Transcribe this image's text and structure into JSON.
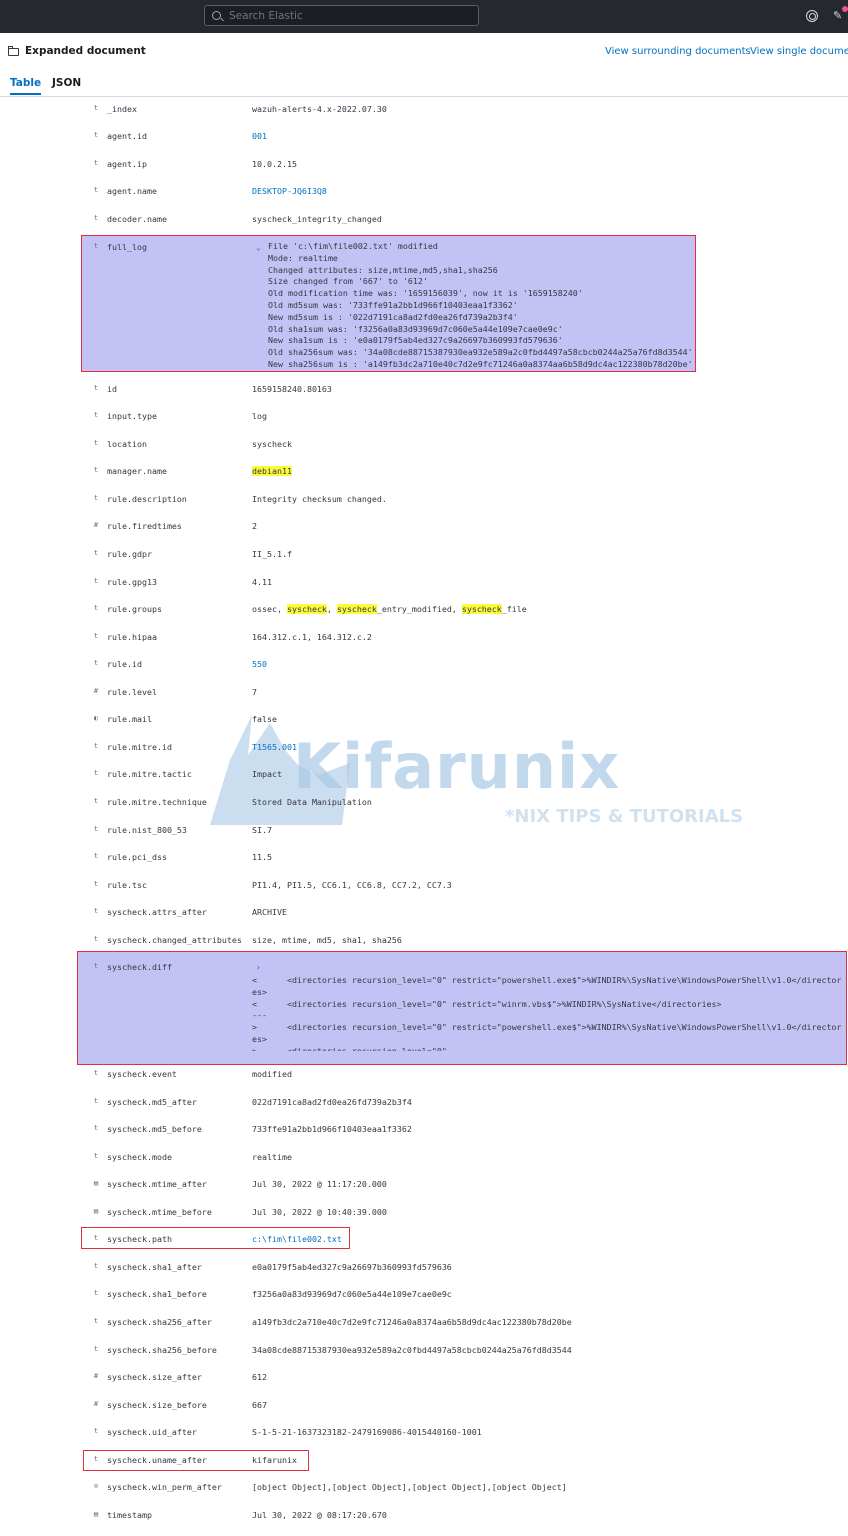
{
  "topbar": {
    "search_placeholder": "Search Elastic"
  },
  "header": {
    "title": "Expanded document",
    "view_surrounding": "View surrounding documents",
    "view_single": "View single document"
  },
  "tabs": {
    "table": "Table",
    "json": "JSON"
  },
  "watermark": {
    "brand": "Kifarunix",
    "tagline": "*NIX TIPS & TUTORIALS"
  },
  "fields": [
    {
      "type": "t",
      "name": "_index",
      "value": "wazuh-alerts-4.x-2022.07.30"
    },
    {
      "type": "t",
      "name": "agent.id",
      "value": "001"
    },
    {
      "type": "t",
      "name": "agent.ip",
      "value": "10.0.2.15"
    },
    {
      "type": "t",
      "name": "agent.name",
      "value": "DESKTOP-JQ6I3Q8"
    },
    {
      "type": "t",
      "name": "decoder.name",
      "value": "syscheck_integrity_changed"
    },
    {
      "type": "t",
      "name": "full_log",
      "value": ""
    },
    {
      "type": "t",
      "name": "id",
      "value": "1659158240.80163"
    },
    {
      "type": "t",
      "name": "input.type",
      "value": "log"
    },
    {
      "type": "t",
      "name": "location",
      "value": "syscheck"
    },
    {
      "type": "t",
      "name": "manager.name",
      "value": "debian11"
    },
    {
      "type": "t",
      "name": "rule.description",
      "value": "Integrity checksum changed."
    },
    {
      "type": "#",
      "name": "rule.firedtimes",
      "value": "2"
    },
    {
      "type": "t",
      "name": "rule.gdpr",
      "value": "II_5.1.f"
    },
    {
      "type": "t",
      "name": "rule.gpg13",
      "value": "4.11"
    },
    {
      "type": "t",
      "name": "rule.groups",
      "value": ""
    },
    {
      "type": "t",
      "name": "rule.hipaa",
      "value": "164.312.c.1, 164.312.c.2"
    },
    {
      "type": "t",
      "name": "rule.id",
      "value": "550"
    },
    {
      "type": "#",
      "name": "rule.level",
      "value": "7"
    },
    {
      "type": "◐",
      "name": "rule.mail",
      "value": "false"
    },
    {
      "type": "t",
      "name": "rule.mitre.id",
      "value": "T1565.001"
    },
    {
      "type": "t",
      "name": "rule.mitre.tactic",
      "value": "Impact"
    },
    {
      "type": "t",
      "name": "rule.mitre.technique",
      "value": "Stored Data Manipulation"
    },
    {
      "type": "t",
      "name": "rule.nist_800_53",
      "value": "SI.7"
    },
    {
      "type": "t",
      "name": "rule.pci_dss",
      "value": "11.5"
    },
    {
      "type": "t",
      "name": "rule.tsc",
      "value": "PI1.4, PI1.5, CC6.1, CC6.8, CC7.2, CC7.3"
    },
    {
      "type": "t",
      "name": "syscheck.attrs_after",
      "value": "ARCHIVE"
    },
    {
      "type": "t",
      "name": "syscheck.changed_attributes",
      "value": "size, mtime, md5, sha1, sha256"
    },
    {
      "type": "t",
      "name": "syscheck.diff",
      "value": ""
    },
    {
      "type": "t",
      "name": "syscheck.event",
      "value": "modified"
    },
    {
      "type": "t",
      "name": "syscheck.md5_after",
      "value": "022d7191ca8ad2fd0ea26fd739a2b3f4"
    },
    {
      "type": "t",
      "name": "syscheck.md5_before",
      "value": "733ffe91a2bb1d966f10403eaa1f3362"
    },
    {
      "type": "t",
      "name": "syscheck.mode",
      "value": "realtime"
    },
    {
      "type": "▤",
      "name": "syscheck.mtime_after",
      "value": "Jul 30, 2022 @ 11:17:20.000"
    },
    {
      "type": "▤",
      "name": "syscheck.mtime_before",
      "value": "Jul 30, 2022 @ 10:40:39.000"
    },
    {
      "type": "t",
      "name": "syscheck.path",
      "value": "c:\\fim\\file002.txt"
    },
    {
      "type": "t",
      "name": "syscheck.sha1_after",
      "value": "e0a0179f5ab4ed327c9a26697b360993fd579636"
    },
    {
      "type": "t",
      "name": "syscheck.sha1_before",
      "value": "f3256a0a83d93969d7c060e5a44e109e7cae0e9c"
    },
    {
      "type": "t",
      "name": "syscheck.sha256_after",
      "value": "a149fb3dc2a710e40c7d2e9fc71246a0a8374aa6b58d9dc4ac122380b78d20be"
    },
    {
      "type": "t",
      "name": "syscheck.sha256_before",
      "value": "34a08cde88715387930ea932e589a2c0fbd4497a58cbcb0244a25a76fd8d3544"
    },
    {
      "type": "#",
      "name": "syscheck.size_after",
      "value": "612"
    },
    {
      "type": "#",
      "name": "syscheck.size_before",
      "value": "667"
    },
    {
      "type": "t",
      "name": "syscheck.uid_after",
      "value": "S-1-5-21-1637323182-2479169086-4015440160-1001"
    },
    {
      "type": "t",
      "name": "syscheck.uname_after",
      "value": "kifarunix"
    },
    {
      "type": "⊙",
      "name": "syscheck.win_perm_after",
      "value": "[object Object],[object Object],[object Object],[object Object]"
    },
    {
      "type": "▤",
      "name": "timestamp",
      "value": "Jul 30, 2022 @ 08:17:20.670"
    }
  ],
  "full_log_lines": [
    "File 'c:\\fim\\file002.txt' modified",
    "Mode: realtime",
    "Changed attributes: size,mtime,md5,sha1,sha256",
    "Size changed from '667' to '612'",
    "Old modification time was: '1659156039', now it is '1659158240'",
    "Old md5sum was: '733ffe91a2bb1d966f10403eaa1f3362'",
    "New md5sum is : '022d7191ca8ad2fd0ea26fd739a2b3f4'",
    "Old sha1sum was: 'f3256a0a83d93969d7c060e5a44e109e7cae0e9c'",
    "New sha1sum is : 'e0a0179f5ab4ed327c9a26697b360993fd579636'",
    "Old sha256sum was: '34a08cde88715387930ea932e589a2c0fbd4497a58cbcb0244a25a76fd8d3544'",
    "New sha256sum is : 'a149fb3dc2a710e40c7d2e9fc71246a0a8374aa6b58d9dc4ac122380b78d20be'"
  ],
  "diff_lines": [
    "<      <directories recursion_level=\"0\" restrict=\"powershell.exe$\">%WINDIR%\\SysNative\\WindowsPowerShell\\v1.0</directori",
    "es>",
    "<      <directories recursion_level=\"0\" restrict=\"winrm.vbs$\">%WINDIR%\\SysNative</directories>",
    "---",
    ">      <directories recursion_level=\"0\" restrict=\"powershell.exe$\">%WINDIR%\\SysNative\\WindowsPowerShell\\v1.0</directori",
    "es>",
    ">      <directories recursion_level=\"0\""
  ],
  "rule_groups_parts": [
    {
      "text": "ossec, ",
      "hl": false
    },
    {
      "text": "syscheck",
      "hl": true
    },
    {
      "text": ", ",
      "hl": false
    },
    {
      "text": "syscheck",
      "hl": true
    },
    {
      "text": "_entry_modified, ",
      "hl": false
    },
    {
      "text": "syscheck",
      "hl": true
    },
    {
      "text": "_file",
      "hl": false
    }
  ],
  "link_values": [
    "agent.id",
    "agent.name",
    "rule.id",
    "rule.mitre.id",
    "syscheck.path"
  ],
  "highlight_values": [
    "manager.name"
  ],
  "colors": {
    "accent": "#0071c2",
    "selection": "#c4c2f5",
    "box": "#e0303e",
    "highlight": "#fcfc3a"
  }
}
